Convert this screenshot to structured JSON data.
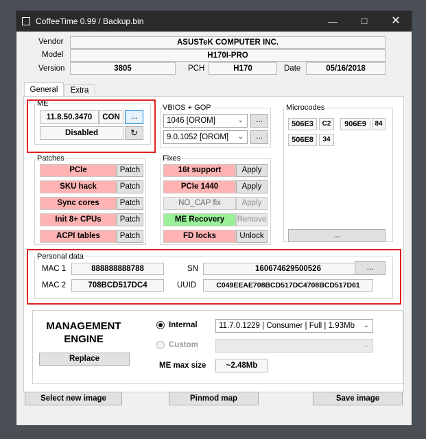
{
  "window": {
    "title": "CoffeeTime 0.99  /  Backup.bin"
  },
  "info": {
    "vendor_label": "Vendor",
    "vendor": "ASUSTeK COMPUTER INC.",
    "model_label": "Model",
    "model": "H170I-PRO",
    "version_label": "Version",
    "version": "3805",
    "pch_label": "PCH",
    "pch": "H170",
    "date_label": "Date",
    "date": "05/16/2018"
  },
  "tabs": [
    {
      "label": "General"
    },
    {
      "label": "Extra"
    }
  ],
  "me": {
    "label": "ME",
    "version": "11.8.50.3470",
    "con": "CON",
    "dots": "...",
    "status": "Disabled"
  },
  "vbios": {
    "label": "VBIOS + GOP",
    "vbios": "1046 [OROM]",
    "gop": "9.0.1052 [OROM]",
    "dots": "..."
  },
  "microcodes": {
    "label": "Microcodes",
    "items": [
      {
        "cpuid": "506E3",
        "ver": "C2"
      },
      {
        "cpuid": "906E9",
        "ver": "84"
      },
      {
        "cpuid": "506E8",
        "ver": "34"
      }
    ],
    "dots": "..."
  },
  "patches": {
    "label": "Patches",
    "items": [
      {
        "name": "PCIe",
        "action": "Patch"
      },
      {
        "name": "SKU hack",
        "action": "Patch"
      },
      {
        "name": "Sync cores",
        "action": "Patch"
      },
      {
        "name": "Init 8+ CPUs",
        "action": "Patch"
      },
      {
        "name": "ACPI tables",
        "action": "Patch"
      }
    ]
  },
  "fixes": {
    "label": "Fixes",
    "items": [
      {
        "name": "16t support",
        "action": "Apply"
      },
      {
        "name": "PCIe 1440",
        "action": "Apply"
      },
      {
        "name": "NO_CAP fix",
        "action": "Apply"
      },
      {
        "name": "ME Recovery",
        "action": "Remove"
      },
      {
        "name": "FD locks",
        "action": "Unlock"
      }
    ]
  },
  "personal": {
    "label": "Personal data",
    "mac1_label": "MAC 1",
    "mac1": "888888888788",
    "mac2_label": "MAC 2",
    "mac2": "708BCD517DC4",
    "sn_label": "SN",
    "sn": "160674629500526",
    "uuid_label": "UUID",
    "uuid": "C049EEAE708BCD517DC4708BCD517D61",
    "dots": "..."
  },
  "engine": {
    "title_line1": "MANAGEMENT",
    "title_line2": "ENGINE",
    "replace": "Replace",
    "internal_label": "Internal",
    "internal_value": "11.7.0.1229 | Consumer | Full | 1.93Mb",
    "custom_label": "Custom",
    "custom_value": "",
    "max_label": "ME max size",
    "max_value": "~2.48Mb"
  },
  "footer": {
    "select": "Select new image",
    "pinmod": "Pinmod map",
    "save": "Save image"
  },
  "colors": {
    "patch_bg": "#ffb3b3",
    "recovery_bg": "#99f099",
    "highlight": "#e02020"
  }
}
